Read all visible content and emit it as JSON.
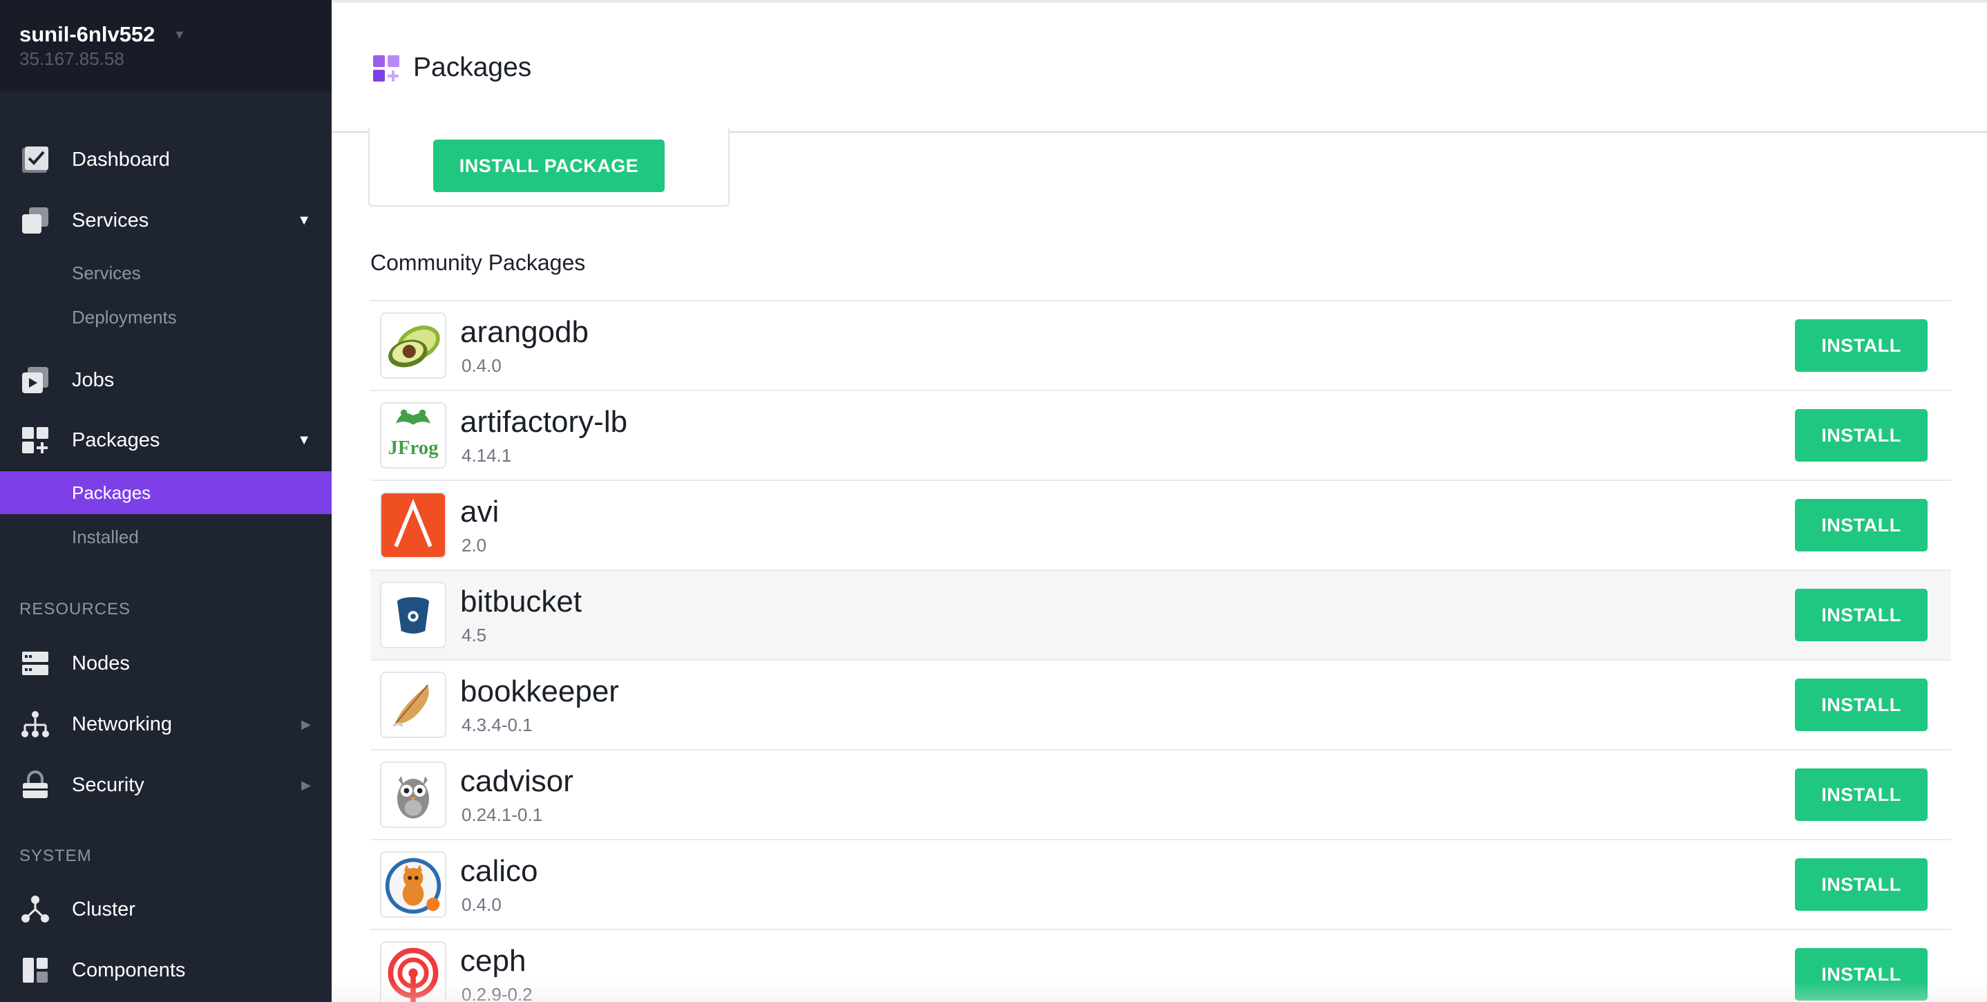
{
  "cluster": {
    "name": "sunil-6nlv552",
    "ip": "35.167.85.58"
  },
  "sidebar": {
    "nav": [
      {
        "label": "Dashboard",
        "icon": "dashboard-icon"
      },
      {
        "label": "Services",
        "icon": "services-icon"
      },
      {
        "label": "Jobs",
        "icon": "jobs-icon"
      },
      {
        "label": "Packages",
        "icon": "packages-icon"
      }
    ],
    "services_sub": [
      {
        "label": "Services"
      },
      {
        "label": "Deployments"
      }
    ],
    "packages_sub": [
      {
        "label": "Packages",
        "active": true
      },
      {
        "label": "Installed"
      }
    ],
    "resources_heading": "RESOURCES",
    "resources": [
      {
        "label": "Nodes",
        "icon": "nodes-icon"
      },
      {
        "label": "Networking",
        "icon": "networking-icon"
      },
      {
        "label": "Security",
        "icon": "security-icon"
      }
    ],
    "system_heading": "SYSTEM",
    "system": [
      {
        "label": "Cluster",
        "icon": "cluster-icon"
      },
      {
        "label": "Components",
        "icon": "components-icon"
      }
    ]
  },
  "header": {
    "title": "Packages",
    "icon": "packages-icon"
  },
  "main": {
    "install_package_label": "INSTALL PACKAGE",
    "community_title": "Community Packages",
    "install_label": "INSTALL",
    "packages": [
      {
        "name": "arangodb",
        "version": "0.4.0",
        "icon": "avocado-icon"
      },
      {
        "name": "artifactory-lb",
        "version": "4.14.1",
        "icon": "jfrog-icon"
      },
      {
        "name": "avi",
        "version": "2.0",
        "icon": "avi-icon"
      },
      {
        "name": "bitbucket",
        "version": "4.5",
        "icon": "bitbucket-icon"
      },
      {
        "name": "bookkeeper",
        "version": "4.3.4-0.1",
        "icon": "feather-icon"
      },
      {
        "name": "cadvisor",
        "version": "0.24.1-0.1",
        "icon": "owl-icon"
      },
      {
        "name": "calico",
        "version": "0.4.0",
        "icon": "cat-icon"
      },
      {
        "name": "ceph",
        "version": "0.2.9-0.2",
        "icon": "ceph-icon"
      }
    ]
  },
  "colors": {
    "sidebar_bg": "#1f2431",
    "sidebar_header_bg": "#181c26",
    "active_purple": "#7d3fe8",
    "install_green": "#1fc780"
  }
}
